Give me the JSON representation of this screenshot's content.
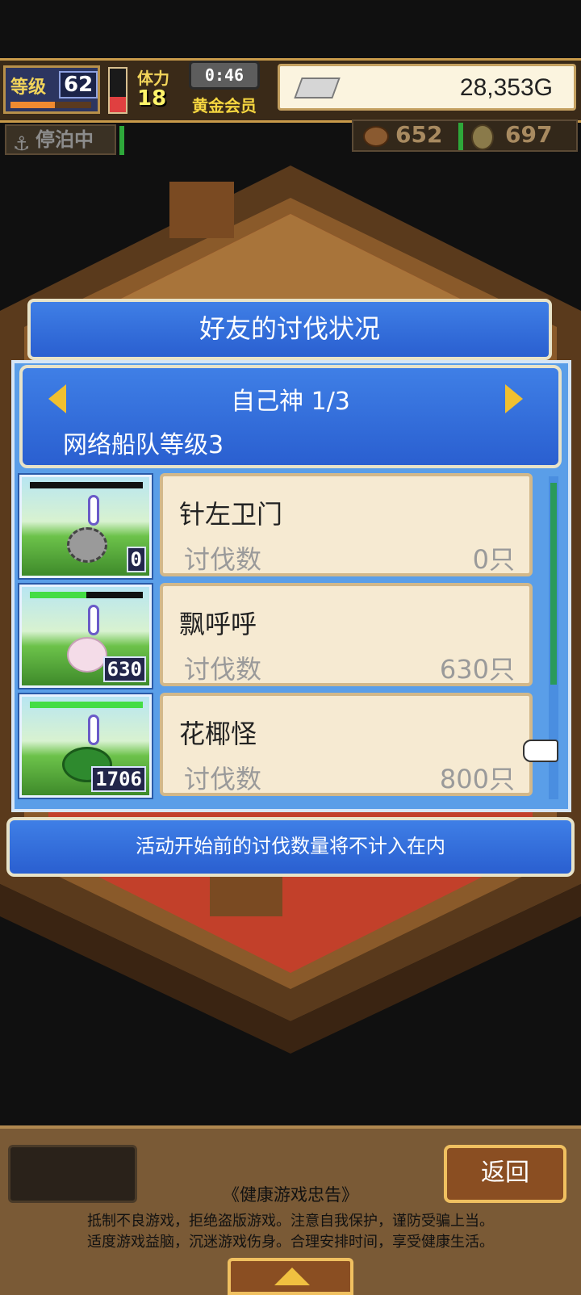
{
  "hud": {
    "level_label": "等级",
    "level": "62",
    "level_progress": 0.55,
    "stamina_label": "体力",
    "stamina": "18",
    "stamina_gauge": 0.35,
    "timer": "0:46",
    "membership": "黄金会员",
    "gold": "28,353G",
    "dock_status": "停泊中",
    "food": "652",
    "coins": "697"
  },
  "dialog": {
    "title": "好友的讨伐状况",
    "friend_name": "自己神 1/3",
    "fleet_level": "网络船队等级3",
    "rows": [
      {
        "monster": "针左卫门",
        "kill_label": "讨伐数",
        "kill_count": "0只",
        "badge": "0",
        "hp": 0.0,
        "monster_icon": "spike-ball-icon"
      },
      {
        "monster": "飘呼呼",
        "kill_label": "讨伐数",
        "kill_count": "630只",
        "badge": "630",
        "hp": 0.5,
        "monster_icon": "ghost-icon"
      },
      {
        "monster": "花椰怪",
        "kill_label": "讨伐数",
        "kill_count": "800只",
        "badge": "1706",
        "hp": 1.0,
        "monster_icon": "broccoli-icon"
      }
    ],
    "notice": "活动开始前的讨伐数量将不计入在内"
  },
  "bottom": {
    "back_label": "返回",
    "advice_title": "《健康游戏忠告》",
    "advice_line1": "抵制不良游戏，拒绝盗版游戏。注意自我保护，谨防受骗上当。",
    "advice_line2": "适度游戏益脑，沉迷游戏伤身。合理安排时间，享受健康生活。"
  },
  "colors": {
    "dialog_blue": "#2a5fd0",
    "card_bg": "#f6ead2",
    "gold_accent": "#f0c030"
  }
}
